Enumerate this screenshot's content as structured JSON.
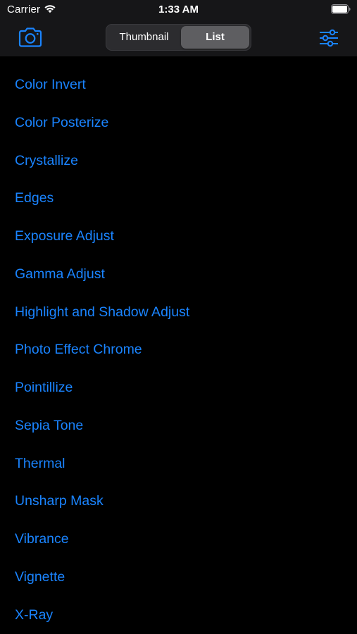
{
  "status_bar": {
    "carrier": "Carrier",
    "time": "1:33 AM",
    "wifi_icon": "wifi-icon",
    "battery_icon": "battery-icon"
  },
  "nav_bar": {
    "camera_icon": "camera-icon",
    "settings_icon": "sliders-icon",
    "segments": [
      {
        "label": "Thumbnail",
        "selected": false
      },
      {
        "label": "List",
        "selected": true
      }
    ]
  },
  "filters": [
    "Color Invert",
    "Color Posterize",
    "Crystallize",
    "Edges",
    "Exposure Adjust",
    "Gamma Adjust",
    "Highlight and Shadow Adjust",
    "Photo Effect Chrome",
    "Pointillize",
    "Sepia Tone",
    "Thermal",
    "Unsharp Mask",
    "Vibrance",
    "Vignette",
    "X-Ray"
  ],
  "colors": {
    "accent": "#1a84ff",
    "background": "#000000",
    "nav_background": "#161618",
    "segment_selected": "#5e5e61"
  }
}
